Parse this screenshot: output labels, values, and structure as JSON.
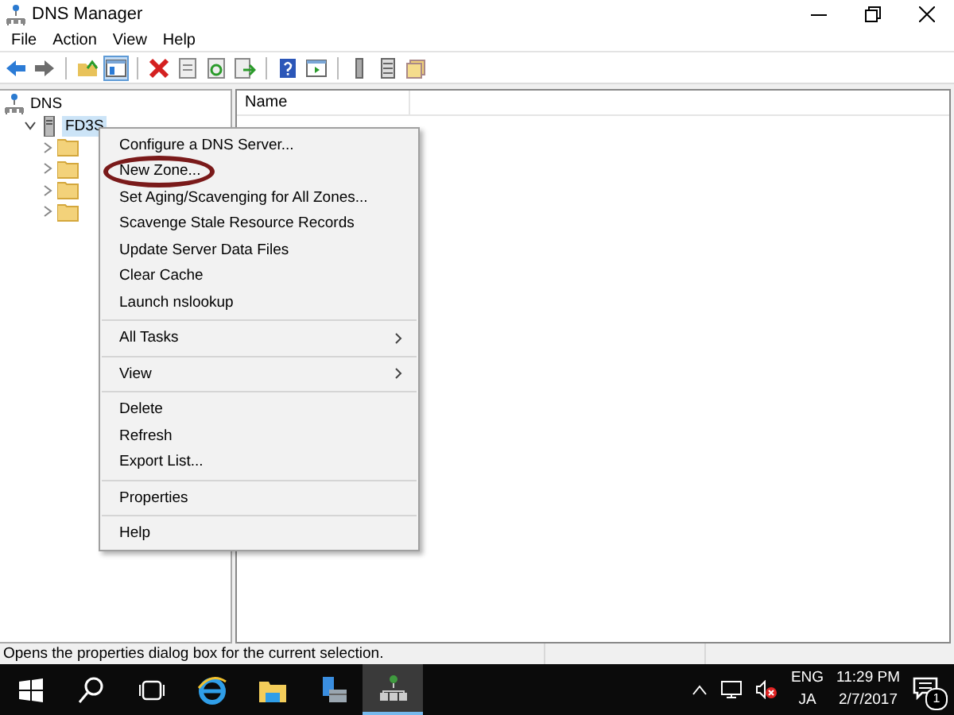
{
  "window": {
    "title": "DNS Manager"
  },
  "menu_bar": [
    "File",
    "Action",
    "View",
    "Help"
  ],
  "toolbar": [
    {
      "kind": "back",
      "pressed": false
    },
    {
      "kind": "forward",
      "pressed": false
    },
    {
      "kind": "separator"
    },
    {
      "kind": "up-folder",
      "pressed": false
    },
    {
      "kind": "show-tree",
      "pressed": true
    },
    {
      "kind": "separator"
    },
    {
      "kind": "delete",
      "pressed": false
    },
    {
      "kind": "properties",
      "pressed": false
    },
    {
      "kind": "refresh",
      "pressed": false
    },
    {
      "kind": "export",
      "pressed": false
    },
    {
      "kind": "separator"
    },
    {
      "kind": "help",
      "pressed": false
    },
    {
      "kind": "console",
      "pressed": false
    },
    {
      "kind": "separator"
    },
    {
      "kind": "server",
      "pressed": false
    },
    {
      "kind": "list",
      "pressed": false
    },
    {
      "kind": "folders",
      "pressed": false
    }
  ],
  "tree": [
    {
      "label": "DNS",
      "kind": "dns",
      "selected": false,
      "children": [
        {
          "label": "FD3S",
          "kind": "server",
          "selected": true,
          "expanded": true,
          "children": [
            {
              "kind": "folder",
              "expanded": false
            },
            {
              "kind": "folder",
              "expanded": false
            },
            {
              "kind": "folder",
              "expanded": false
            },
            {
              "kind": "folder",
              "expanded": false
            }
          ]
        }
      ]
    }
  ],
  "list": {
    "columns": [
      "Name"
    ]
  },
  "context_menu": {
    "items": [
      {
        "kind": "item",
        "label": "Configure a DNS Server...",
        "highlighted": false
      },
      {
        "kind": "item",
        "label": "New Zone...",
        "highlighted": true
      },
      {
        "kind": "item",
        "label": "Set Aging/Scavenging for All Zones...",
        "highlighted": false
      },
      {
        "kind": "item",
        "label": "Scavenge Stale Resource Records",
        "highlighted": false
      },
      {
        "kind": "item",
        "label": "Update Server Data Files",
        "highlighted": false
      },
      {
        "kind": "item",
        "label": "Clear Cache",
        "highlighted": false
      },
      {
        "kind": "item",
        "label": "Launch nslookup",
        "highlighted": false
      },
      {
        "kind": "separator"
      },
      {
        "kind": "submenu",
        "label": "All Tasks",
        "highlighted": false
      },
      {
        "kind": "separator"
      },
      {
        "kind": "submenu",
        "label": "View",
        "highlighted": false
      },
      {
        "kind": "separator"
      },
      {
        "kind": "item",
        "label": "Delete",
        "highlighted": false
      },
      {
        "kind": "item",
        "label": "Refresh",
        "highlighted": false
      },
      {
        "kind": "item",
        "label": "Export List...",
        "highlighted": false
      },
      {
        "kind": "separator"
      },
      {
        "kind": "item",
        "label": "Properties",
        "highlighted": false
      },
      {
        "kind": "separator"
      },
      {
        "kind": "item",
        "label": "Help",
        "highlighted": false
      }
    ]
  },
  "status_bar": "Opens the properties dialog box for the current selection.",
  "taskbar": {
    "apps": [
      {
        "kind": "start",
        "active": false
      },
      {
        "kind": "search",
        "active": false
      },
      {
        "kind": "task-view",
        "active": false
      },
      {
        "kind": "browser",
        "active": false
      },
      {
        "kind": "explorer",
        "active": false
      },
      {
        "kind": "server-manager",
        "active": false
      },
      {
        "kind": "dns",
        "active": true
      }
    ],
    "language": [
      "ENG",
      "JA"
    ],
    "time": "11:29 PM",
    "date": "2/7/2017",
    "notifications": "1"
  }
}
